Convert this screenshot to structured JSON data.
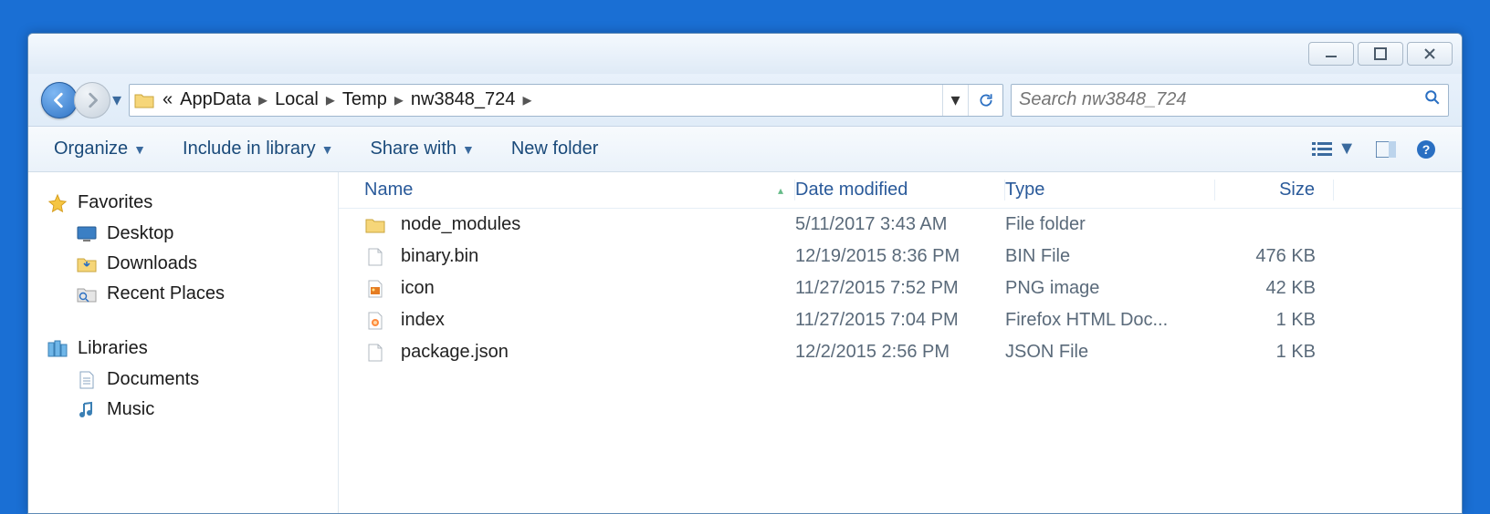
{
  "window_controls": {
    "minimize": "minimize",
    "maximize": "maximize",
    "close": "close"
  },
  "address": {
    "overflow": "«",
    "crumbs": [
      "AppData",
      "Local",
      "Temp",
      "nw3848_724"
    ]
  },
  "search": {
    "placeholder": "Search nw3848_724"
  },
  "toolbar": {
    "organize": "Organize",
    "include": "Include in library",
    "share": "Share with",
    "newfolder": "New folder"
  },
  "sidebar": {
    "favorites": {
      "label": "Favorites",
      "items": [
        "Desktop",
        "Downloads",
        "Recent Places"
      ]
    },
    "libraries": {
      "label": "Libraries",
      "items": [
        "Documents",
        "Music"
      ]
    }
  },
  "columns": {
    "name": "Name",
    "date": "Date modified",
    "type": "Type",
    "size": "Size"
  },
  "files": [
    {
      "icon": "folder",
      "name": "node_modules",
      "date": "5/11/2017 3:43 AM",
      "type": "File folder",
      "size": ""
    },
    {
      "icon": "file",
      "name": "binary.bin",
      "date": "12/19/2015 8:36 PM",
      "type": "BIN File",
      "size": "476 KB"
    },
    {
      "icon": "png",
      "name": "icon",
      "date": "11/27/2015 7:52 PM",
      "type": "PNG image",
      "size": "42 KB"
    },
    {
      "icon": "html",
      "name": "index",
      "date": "11/27/2015 7:04 PM",
      "type": "Firefox HTML Doc...",
      "size": "1 KB"
    },
    {
      "icon": "file",
      "name": "package.json",
      "date": "12/2/2015 2:56 PM",
      "type": "JSON File",
      "size": "1 KB"
    }
  ]
}
